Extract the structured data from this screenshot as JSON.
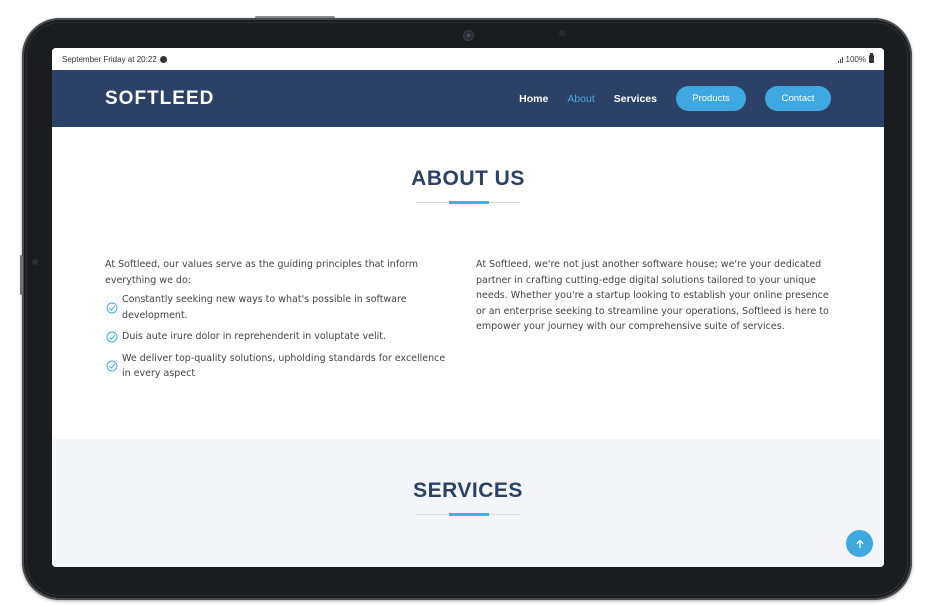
{
  "status_bar": {
    "datetime": "September Friday at 20:22",
    "battery": "100%"
  },
  "navbar": {
    "brand": "SOFTLEED",
    "links": [
      "Home",
      "About",
      "Services"
    ],
    "active_link": "About",
    "buttons": [
      "Products",
      "Contact"
    ]
  },
  "about": {
    "title": "ABOUT US",
    "intro": "At Softleed, our values serve as the guiding principles that inform everything we do:",
    "values": [
      "Constantly seeking new ways to what's possible in software development.",
      "Duis aute irure dolor in reprehenderit in voluptate velit.",
      "We deliver top-quality solutions, upholding standards for excellence in every aspect"
    ],
    "description": "At Softleed, we're not just another software house; we're your dedicated partner in crafting cutting-edge digital solutions tailored to your unique needs. Whether you're a startup looking to establish your online presence or an enterprise seeking to streamline your operations, Softleed is here to empower your journey with our comprehensive suite of services."
  },
  "services": {
    "title": "SERVICES"
  },
  "colors": {
    "navbar_bg": "#2c4167",
    "accent": "#3ea9e0",
    "heading": "#2c4167",
    "services_bg": "#f3f5f8"
  },
  "icons": {
    "notification": "notification-icon",
    "signal": "signal-icon",
    "battery": "battery-icon",
    "check": "check-circle-icon",
    "back_to_top": "arrow-up-icon"
  }
}
